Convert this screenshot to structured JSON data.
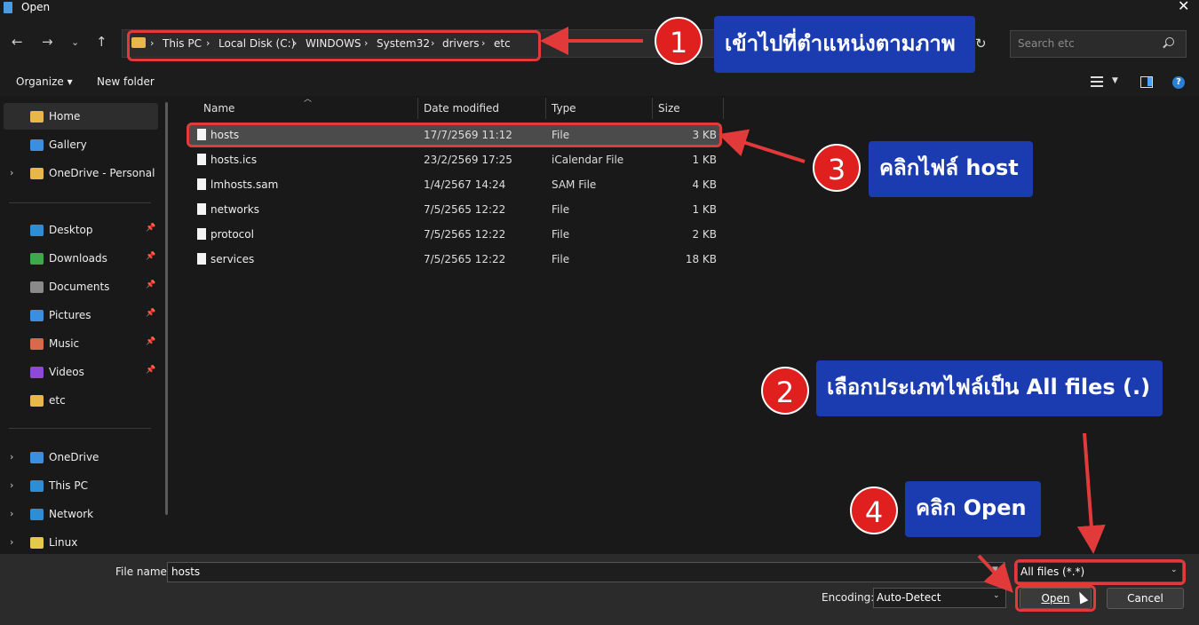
{
  "window": {
    "title": "Open"
  },
  "nav": {
    "breadcrumbs": [
      "This PC",
      "Local Disk (C:)",
      "WINDOWS",
      "System32",
      "drivers",
      "etc"
    ],
    "search_placeholder": "Search etc"
  },
  "toolbar": {
    "organize": "Organize ▾",
    "new_folder": "New folder"
  },
  "sidebar": {
    "quick": [
      {
        "label": "Home",
        "color": "#e8b64a"
      },
      {
        "label": "Gallery",
        "color": "#3b8ee0"
      },
      {
        "label": "OneDrive - Personal",
        "color": "#e8b64a"
      }
    ],
    "pinned": [
      {
        "label": "Desktop",
        "color": "#2d8ed6"
      },
      {
        "label": "Downloads",
        "color": "#3fa84a"
      },
      {
        "label": "Documents",
        "color": "#8a8a8a"
      },
      {
        "label": "Pictures",
        "color": "#3b8ee0"
      },
      {
        "label": "Music",
        "color": "#d66a4a"
      },
      {
        "label": "Videos",
        "color": "#8e4ad6"
      },
      {
        "label": "etc",
        "color": "#e8b64a"
      }
    ],
    "locations": [
      {
        "label": "OneDrive",
        "color": "#3b8ee0"
      },
      {
        "label": "This PC",
        "color": "#2d8ed6"
      },
      {
        "label": "Network",
        "color": "#2d8ed6"
      },
      {
        "label": "Linux",
        "color": "#e6c84a"
      }
    ]
  },
  "columns": {
    "name": "Name",
    "date": "Date modified",
    "type": "Type",
    "size": "Size"
  },
  "files": [
    {
      "name": "hosts",
      "date": "17/7/2569 11:12",
      "type": "File",
      "size": "3 KB"
    },
    {
      "name": "hosts.ics",
      "date": "23/2/2569 17:25",
      "type": "iCalendar File",
      "size": "1 KB"
    },
    {
      "name": "lmhosts.sam",
      "date": "1/4/2567 14:24",
      "type": "SAM File",
      "size": "4 KB"
    },
    {
      "name": "networks",
      "date": "7/5/2565 12:22",
      "type": "File",
      "size": "1 KB"
    },
    {
      "name": "protocol",
      "date": "7/5/2565 12:22",
      "type": "File",
      "size": "2 KB"
    },
    {
      "name": "services",
      "date": "7/5/2565 12:22",
      "type": "File",
      "size": "18 KB"
    }
  ],
  "bottom": {
    "file_name_label": "File name:",
    "file_name_value": "hosts",
    "file_type_value": "All files  (*.*)",
    "encoding_label": "Encoding:",
    "encoding_value": "Auto-Detect",
    "open_label": "Open",
    "cancel_label": "Cancel"
  },
  "annotations": [
    {
      "number": "1",
      "text": "เข้าไปที่ตำแหน่งตามภาพ"
    },
    {
      "number": "2",
      "text": "เลือกประเภทไฟล์เป็น All files (.)"
    },
    {
      "number": "3",
      "text": "คลิกไฟล์ host"
    },
    {
      "number": "4",
      "text": "คลิก Open"
    }
  ]
}
